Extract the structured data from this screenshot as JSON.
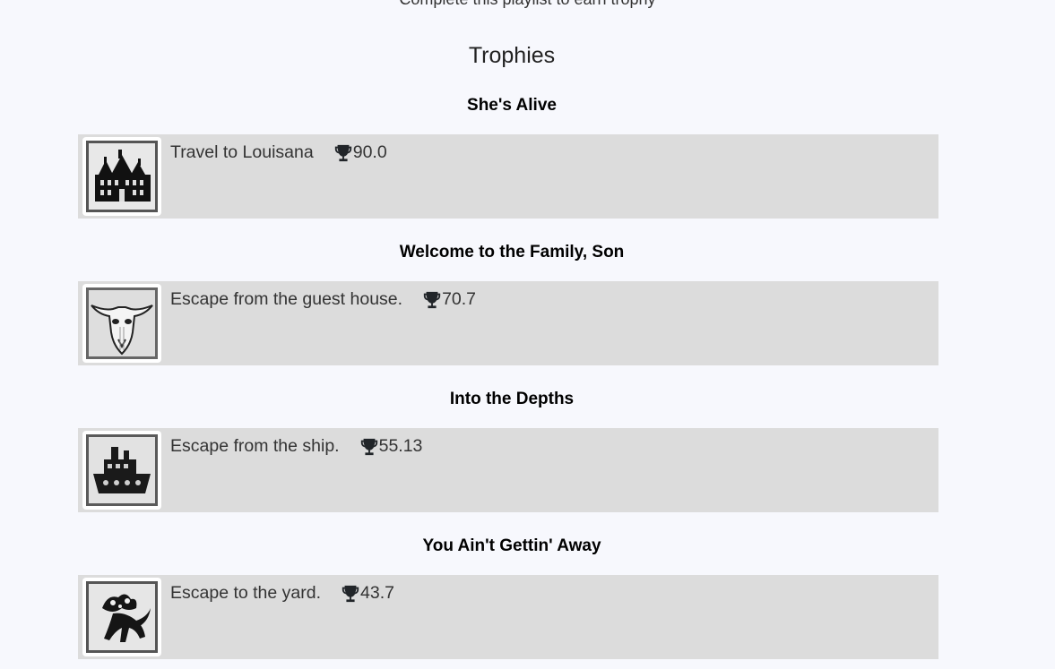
{
  "header": {
    "clipped_text": "Complete this playlist to earn trophy",
    "section_title": "Trophies"
  },
  "trophies": [
    {
      "name": "She's Alive",
      "description": "Travel to Louisana",
      "score": "90.0",
      "icon": "mansion-icon"
    },
    {
      "name": "Welcome to the Family, Son",
      "description": "Escape from the guest house.",
      "score": "70.7",
      "icon": "bull-skull-icon"
    },
    {
      "name": "Into the Depths",
      "description": "Escape from the ship.",
      "score": "55.13",
      "icon": "ship-icon"
    },
    {
      "name": "You Ain't Gettin' Away",
      "description": "Escape to the yard.",
      "score": "43.7",
      "icon": "creature-icon"
    }
  ],
  "colors": {
    "background": "#f7f8fd",
    "card_background": "#dcdcdc",
    "text": "#333333"
  }
}
